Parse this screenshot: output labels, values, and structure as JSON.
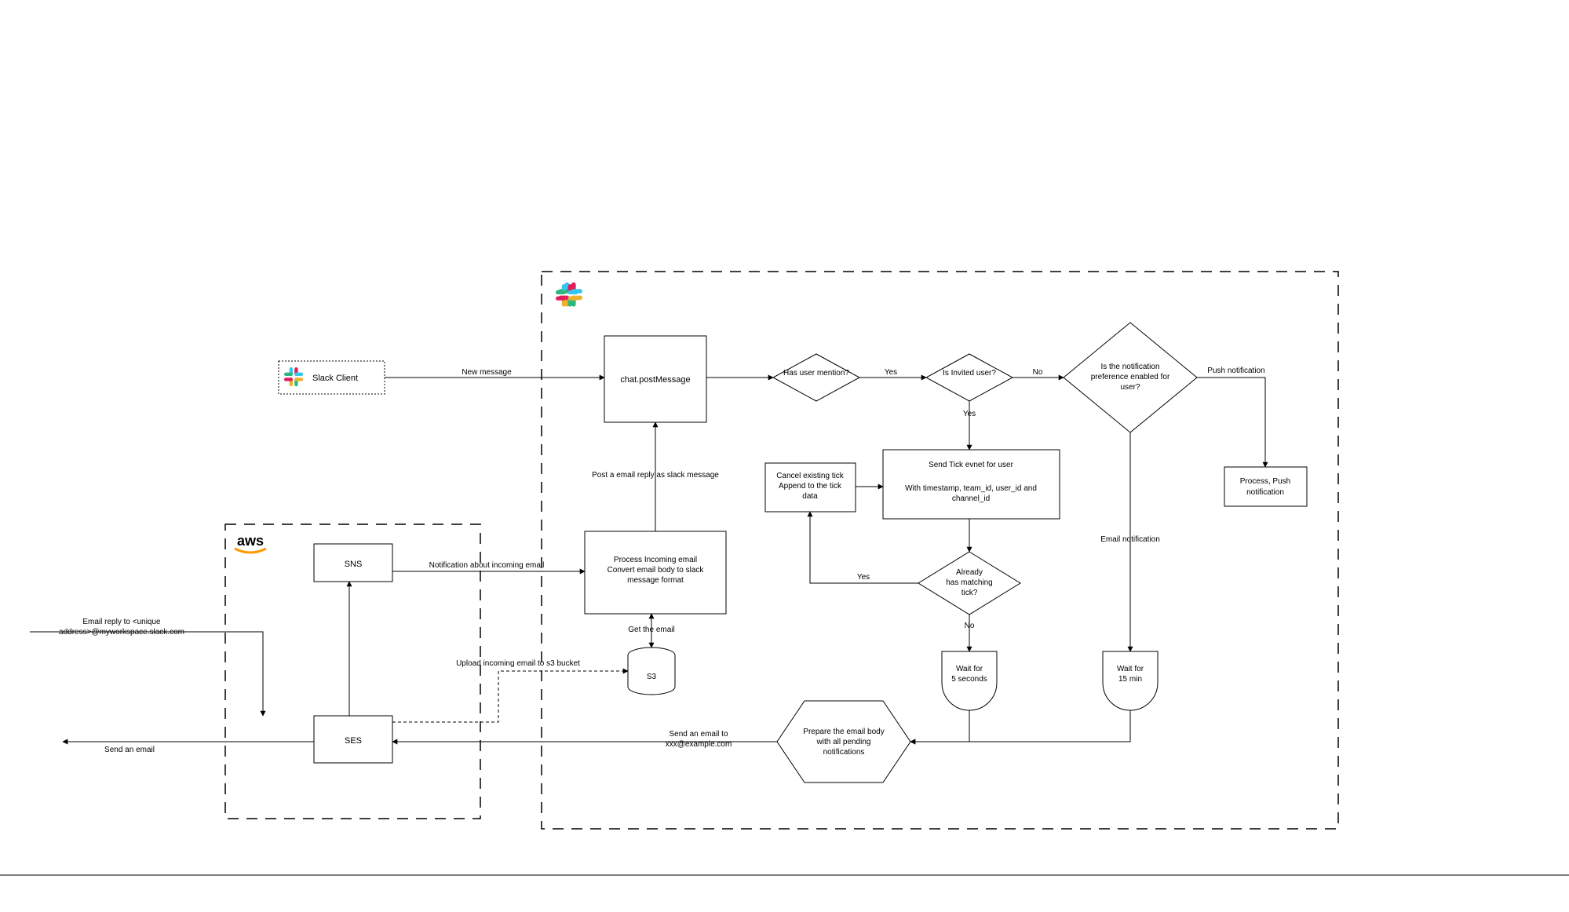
{
  "nodes": {
    "slack_client": "Slack Client",
    "chat_post": "chat.postMessage",
    "has_mention": "Has user mention?",
    "is_invited": "Is Invited user?",
    "pref_line1": "Is the notification",
    "pref_line2": "preference enabled for",
    "pref_line3": "user?",
    "push_box_l1": "Process, Push",
    "push_box_l2": "notification",
    "cancel_l1": "Cancel existing tick",
    "cancel_l2": "Append to the tick",
    "cancel_l3": "data",
    "tick_l1": "Send Tick evnet for user",
    "tick_l2": "With timestamp, team_id, user_id and",
    "tick_l3": "channel_id",
    "match_l1": "Already",
    "match_l2": "has matching",
    "match_l3": "tick?",
    "wait5_l1": "Wait for",
    "wait5_l2": "5 seconds",
    "wait15_l1": "Wait for",
    "wait15_l2": "15 min",
    "prep_l1": "Prepare the email body",
    "prep_l2": "with all pending",
    "prep_l3": "notifications",
    "process_l1": "Process Incoming email",
    "process_l2": "Convert  email body to slack",
    "process_l3": "message format",
    "s3": "S3",
    "sns": "SNS",
    "ses": "SES",
    "aws": "aws"
  },
  "edges": {
    "new_msg": "New message",
    "yes": "Yes",
    "no": "No",
    "push_notif": "Push notification",
    "email_notif": "Email notification",
    "post_reply": "Post a email reply as slack message",
    "get_email": "Get the email",
    "upload_s3": "Upload incoming email to s3 bucket",
    "notif_incoming": "Notification about incoming email",
    "send_email_to1": "Send an email to",
    "send_email_to2": "xxx@example.com",
    "email_reply1": "Email reply to <unique",
    "email_reply2": "address>@myworkspace.slack.com",
    "send_an_email": "Send an email"
  }
}
